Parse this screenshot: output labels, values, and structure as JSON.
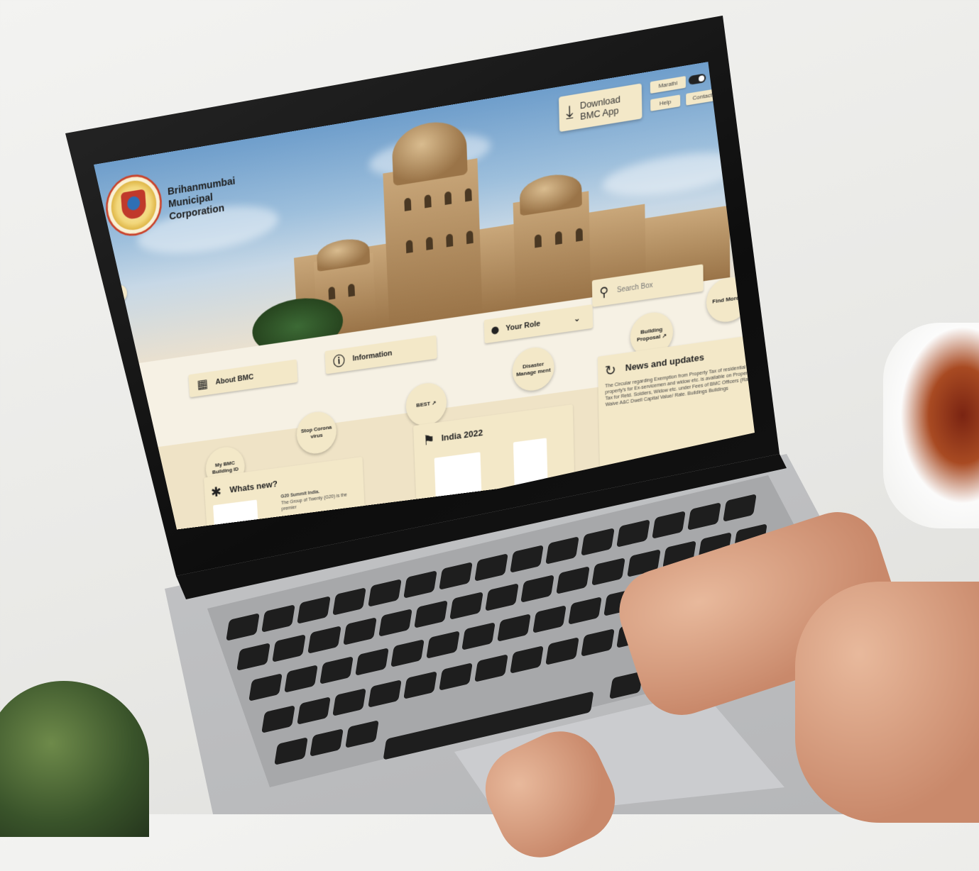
{
  "site": {
    "org_name": "Brihanmumbai Municipal Corporation",
    "download": "Download BMC App",
    "language": "Marathi",
    "help": "Help",
    "contact": "Contact"
  },
  "hero": {
    "prev_arrow": "‹",
    "next_arrow": "›"
  },
  "search": {
    "placeholder": "Search Box"
  },
  "role": {
    "label": "Your Role"
  },
  "tiles": {
    "about": "About BMC",
    "information": "Information"
  },
  "quick_links": {
    "building_proposal": "Building Proposal ↗",
    "find_more": "Find More...",
    "disaster": "Disaster Manage ment",
    "best": "BEST ↗",
    "stop_corona": "Stop Corona virus",
    "my_bmc": "My BMC Building ID"
  },
  "news": {
    "title": "News and updates",
    "body": "The Circular regarding Exemption from Property Tax of residential property's for Ex-servicemen and widow etc. is available on Property Tax for Retd. Soldiers, Widow etc. under Fees of BMC Officers (Rate) Waive A&C Dwell Capital Value/ Rate. Buildings Buildings"
  },
  "india": {
    "title": "India 2022"
  },
  "whats_new": {
    "title": "Whats new?",
    "item_title": "G20 Summit India.",
    "item_body": "The Group of Twenty (G20) is the premier"
  },
  "icons": {
    "download": "download-icon",
    "search": "search-icon",
    "user": "user-icon",
    "chevron": "chevron-down-icon",
    "building": "building-icon",
    "info": "info-icon",
    "clock": "history-icon",
    "flag": "flag-icon",
    "alert": "alert-icon"
  },
  "colors": {
    "tile_bg": "#f3e8c8",
    "page_bg": "#f6f1e4"
  }
}
